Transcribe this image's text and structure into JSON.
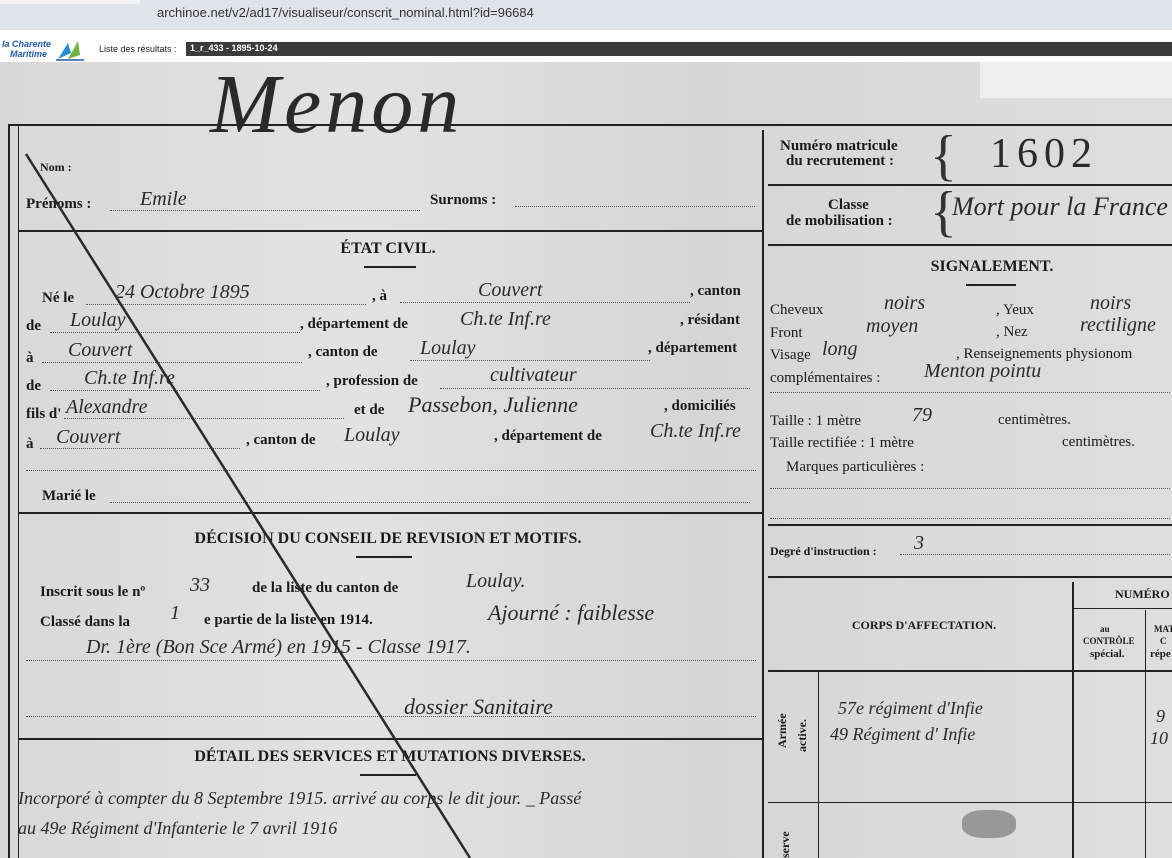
{
  "browser": {
    "url": "archinoe.net/v2/ad17/visualiseur/conscrit_nominal.html?id=96684"
  },
  "viewer": {
    "logo_line1": "la Charente",
    "logo_line2": "Maritime",
    "results_label": "Liste des résultats :",
    "results_value": "1_r_433 - 1895-10-24"
  },
  "form": {
    "nom_label": "Nom :",
    "nom_value": "Menon",
    "prenoms_label": "Prénoms :",
    "prenoms_value": "Emile",
    "surnoms_label": "Surnoms :",
    "matricule_label_1": "Numéro matricule",
    "matricule_label_2": "du recrutement :",
    "matricule_value": "1602",
    "classe_label_1": "Classe",
    "classe_label_2": "de mobilisation :",
    "classe_value": "Mort pour la France",
    "etat_civil": {
      "title": "ÉTAT CIVIL.",
      "ne_le": "Né le",
      "date_naissance": "24 Octobre 1895",
      "a": ", à",
      "lieu_naissance": "Couvert",
      "canton": ", canton",
      "de1": "de",
      "canton_value": "Loulay",
      "departement_de": ", département de",
      "dept_value": "Ch.te Inf.re",
      "residant": ", résidant",
      "a2": "à",
      "residence": "Couvert",
      "canton_de": ", canton de",
      "canton_res": "Loulay",
      "departement": ", département",
      "de2": "de",
      "dept_res": "Ch.te Inf.re",
      "profession_de": ", profession de",
      "profession": "cultivateur",
      "fils_de": "fils d'",
      "pere": "Alexandre",
      "et_de": "et de",
      "mere": "Passebon, Julienne",
      "domicilies": ", domiciliés",
      "a3": "à",
      "domicile": "Couvert",
      "canton_de2": ", canton de",
      "canton_dom": "Loulay",
      "departement_de2": ", département de",
      "dept_dom": "Ch.te Inf.re",
      "marie_le": "Marié le"
    },
    "decision": {
      "title": "DÉCISION DU CONSEIL DE REVISION ET MOTIFS.",
      "inscrit": "Inscrit sous le nº",
      "numero": "33",
      "de_la_liste": "de la liste du canton de",
      "canton": "Loulay.",
      "classe_dans": "Classé dans la",
      "partie": "1",
      "partie_suffix": "e partie de la liste en 1914.",
      "motif_1": "Ajourné : faiblesse",
      "line2": "Dr. 1ère (Bon Sce Armé) en 1915 - Classe 1917.",
      "line3": "dossier Sanitaire"
    },
    "services": {
      "title": "DÉTAIL DES SERVICES ET MUTATIONS DIVERSES.",
      "line1": "Incorporé à compter du 8 Septembre 1915. arrivé au corps le dit jour. _ Passé",
      "line2": "au 49e Régiment d'Infanterie le 7 avril 1916"
    },
    "signalement": {
      "title": "SIGNALEMENT.",
      "cheveux": "Cheveux",
      "cheveux_value": "noirs",
      "yeux": ", Yeux",
      "yeux_value": "noirs",
      "front": "Front",
      "front_value": "moyen",
      "nez": ", Nez",
      "nez_value": "rectiligne",
      "visage": "Visage",
      "visage_value": "long",
      "renseignements": ", Renseignements physionom",
      "complementaires": "complémentaires :",
      "complementaires_value": "Menton pointu",
      "taille": "Taille : 1 mètre",
      "taille_value": "79",
      "centimetres": "centimètres.",
      "taille_rectifiee": "Taille rectifiée : 1 mètre",
      "centimetres2": "centimètres.",
      "marques": "Marques particulières :"
    },
    "instruction": {
      "label": "Degré d'instruction :",
      "value": "3"
    },
    "corps": {
      "title": "CORPS D'AFFECTATION.",
      "numero_header": "NUMÉRO",
      "col1_a": "au",
      "col1_b": "CONTRÔLE",
      "col1_c": "spécial.",
      "col2_a": "MAT",
      "col2_b": "C",
      "col2_c": "répe",
      "armee_label_1": "Armée",
      "armee_label_2": "active.",
      "armee_line1": "57e régiment d'Infie",
      "armee_line2": "49 Régiment d' Infie",
      "num_1": "9",
      "num_2": "10",
      "reserve_label": "serve"
    }
  }
}
